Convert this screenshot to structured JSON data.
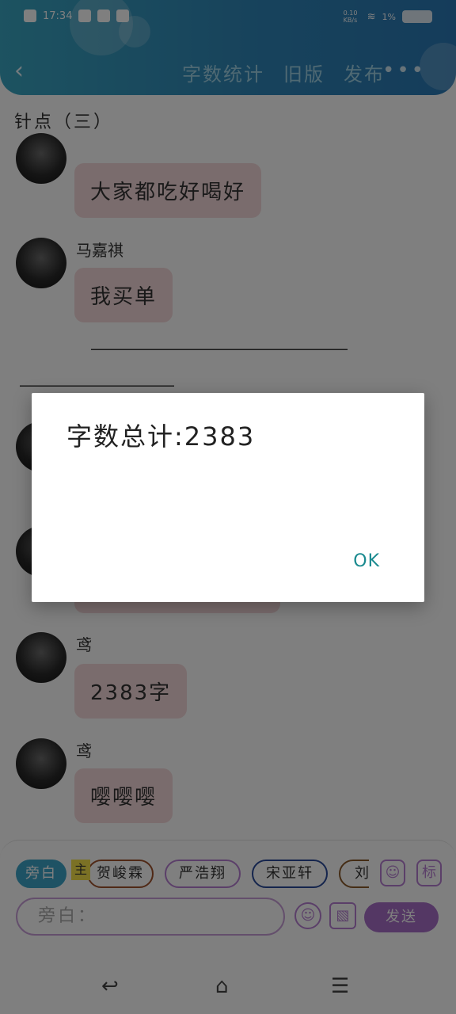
{
  "status_bar": {
    "time": "17:34",
    "speed": "0.10 KB/s",
    "signal_pct": "1%"
  },
  "header": {
    "actions": [
      "字数统计",
      "旧版",
      "发布"
    ],
    "more_label": "•••"
  },
  "chat": {
    "title": "针点（三）",
    "messages": [
      {
        "sender": "",
        "text": "大家都吃好喝好"
      },
      {
        "sender": "马嘉祺",
        "text": "我买单"
      },
      {
        "sender": "",
        "text": ""
      },
      {
        "sender": "",
        "text": ""
      },
      {
        "sender": "鸢",
        "text": "2383字"
      },
      {
        "sender": "鸢",
        "text": "嘤嘤嘤"
      }
    ],
    "divider": "——————————————————"
  },
  "input_area": {
    "role_chips": [
      "旁白",
      "贺峻霖",
      "严浩翔",
      "宋亚轩",
      "刘"
    ],
    "host_mark": "主",
    "side_icons": [
      "person-icon",
      "tag-icon"
    ],
    "tag_label": "标",
    "placeholder": "旁白：",
    "send_label": "发送"
  },
  "dialog": {
    "message": "字数总计:2383",
    "ok_label": "OK"
  },
  "colors": {
    "header": "#2f86b8",
    "bubble": "#f4d9da",
    "accent_purple": "#a86ec8",
    "ok_teal": "#1a8a8f"
  }
}
